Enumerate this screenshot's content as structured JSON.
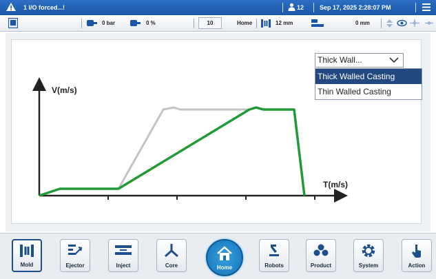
{
  "topbar": {
    "alarm_text": "1 I/O forced...!",
    "user_count": "12",
    "datetime": "Sep 17, 2025 2:28:07 PM",
    "icons": [
      "warning-icon",
      "user-icon",
      "menu-icon"
    ]
  },
  "statusbar": {
    "pressure_value": "0 bar",
    "percent_value": "0 %",
    "counter_value": "10",
    "mode": "Home",
    "stroke_value": "12 mm",
    "position_value": "0 mm",
    "icons": [
      "machine-icon",
      "pressure-icon",
      "percent-icon",
      "mold-stroke-icon",
      "position-icon",
      "eye-icon",
      "arrow-icon"
    ]
  },
  "chart": {
    "y_label": "V(m/s)",
    "x_label": "T(m/s)"
  },
  "chart_data": {
    "type": "line",
    "title": "",
    "xlabel": "T(m/s)",
    "ylabel": "V(m/s)",
    "x_ticks": [
      1,
      2,
      3,
      4
    ],
    "series": [
      {
        "name": "",
        "color": "#c4c4c4",
        "x": [
          0,
          0.3,
          1.15,
          1.8,
          1.95,
          2.05,
          3.05,
          3.15,
          3.25,
          3.7,
          3.85
        ],
        "y": [
          0,
          0.1,
          0.1,
          1.25,
          1.28,
          1.25,
          1.25,
          1.28,
          1.25,
          1.25,
          0
        ]
      },
      {
        "name": "",
        "color": "#1f9a36",
        "x": [
          0,
          0.3,
          1.15,
          3.05,
          3.15,
          3.25,
          3.7,
          3.85
        ],
        "y": [
          0,
          0.1,
          0.1,
          1.25,
          1.28,
          1.25,
          1.25,
          0
        ]
      }
    ],
    "grid": false
  },
  "dropdown": {
    "selected": "Thick Wall...",
    "options": [
      "Thick Walled Casting",
      "Thin Walled Casting"
    ],
    "highlight_color": "#21497f"
  },
  "nav": {
    "mold": "Mold",
    "ejector": "Ejector",
    "inject": "Inject",
    "core": "Core",
    "home": "Home",
    "robots": "Robots",
    "product": "Product",
    "system": "System",
    "action": "Action"
  },
  "colors": {
    "topbar": "#1a56a8",
    "accent": "#1773b8",
    "green_curve": "#1f9a36",
    "gray_curve": "#c4c4c4"
  }
}
